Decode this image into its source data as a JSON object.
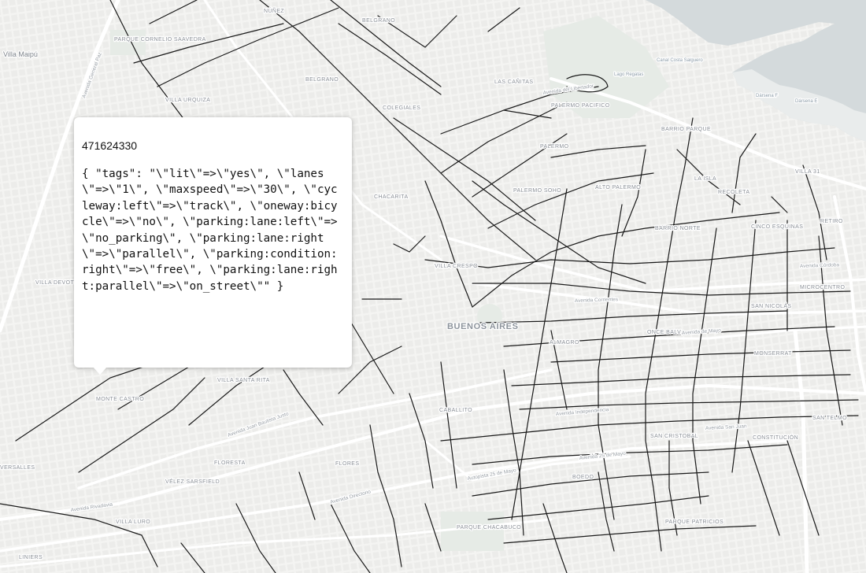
{
  "map": {
    "city_label": "BUENOS AIRES",
    "neighborhoods": [
      {
        "name": "NÚÑEZ"
      },
      {
        "name": "BELGRANO"
      },
      {
        "name": "PARQUE CORNELIO SAAVEDRA"
      },
      {
        "name": "Villa Maipú"
      },
      {
        "name": "BELGRANO"
      },
      {
        "name": "LAS CAÑITAS"
      },
      {
        "name": "VILLA URQUIZA"
      },
      {
        "name": "COLEGIALES"
      },
      {
        "name": "PALERMO PACIFICO"
      },
      {
        "name": "BARRIO PARQUE"
      },
      {
        "name": "PALERMO"
      },
      {
        "name": "LA ISLA"
      },
      {
        "name": "RECOLETA"
      },
      {
        "name": "CHACARITA"
      },
      {
        "name": "PALERMO SOHO"
      },
      {
        "name": "ALTO PALERMO"
      },
      {
        "name": "BARRIO NORTE"
      },
      {
        "name": "CINCO ESQUINAS"
      },
      {
        "name": "RETIRO"
      },
      {
        "name": "VILLA CRESPO"
      },
      {
        "name": "VILLA DEVOTO"
      },
      {
        "name": "MICROCENTRO"
      },
      {
        "name": "SAN NICOLÁS"
      },
      {
        "name": "ALMAGRO"
      },
      {
        "name": "ONCE BALV."
      },
      {
        "name": "MONSERRAT"
      },
      {
        "name": "VILLA SANTA RITA"
      },
      {
        "name": "MONTE CASTRO"
      },
      {
        "name": "CABALLITO"
      },
      {
        "name": "SAN TELMO"
      },
      {
        "name": "CONSTITUCIÓN"
      },
      {
        "name": "SAN CRISTOBAL"
      },
      {
        "name": "FLORESTA"
      },
      {
        "name": "FLORES"
      },
      {
        "name": "VÉLEZ SARSFIELD"
      },
      {
        "name": "BOEDO"
      },
      {
        "name": "VILLA LURO"
      },
      {
        "name": "PARQUE CHACABUCO"
      },
      {
        "name": "PARQUE PATRICIOS"
      },
      {
        "name": "LINIERS"
      },
      {
        "name": "VERSALLES"
      },
      {
        "name": "VILLA 31"
      }
    ],
    "roads": [
      "Avenida General Paz",
      "Avenida Rivadavia",
      "Avenida Juan Bautista Justo",
      "Avenida Independencia",
      "Avenida 25 de Mayo",
      "Avenida Directorio",
      "Avenida Corrientes",
      "Avenida de Mayo",
      "Avenida del Libertador",
      "Autopista 25 de Mayo",
      "Avenida Córdoba",
      "Avenida San Juan"
    ],
    "water_labels": [
      "Dársena F",
      "Dársena E",
      "Lago Regatas",
      "Canal Costa Salguero"
    ]
  },
  "popup": {
    "feature_id": "471624330",
    "tags_text": "{ \"tags\": \"\\\"lit\\\"=>\\\"yes\\\", \\\"lanes\\\"=>\\\"1\\\", \\\"maxspeed\\\"=>\\\"30\\\", \\\"cycleway:left\\\"=>\\\"track\\\", \\\"oneway:bicycle\\\"=>\\\"no\\\", \\\"parking:lane:left\\\"=>\\\"no_parking\\\", \\\"parking:lane:right\\\"=>\\\"parallel\\\", \\\"parking:condition:right\\\"=>\\\"free\\\", \\\"parking:lane:right:parallel\\\"=>\\\"on_street\\\"\" }"
  },
  "colors": {
    "land": "#f4f4f2",
    "water": "#d4dadc",
    "park": "#e6ebe6",
    "bike_lane": "#1a1a1a",
    "major_road": "#ffffff"
  }
}
